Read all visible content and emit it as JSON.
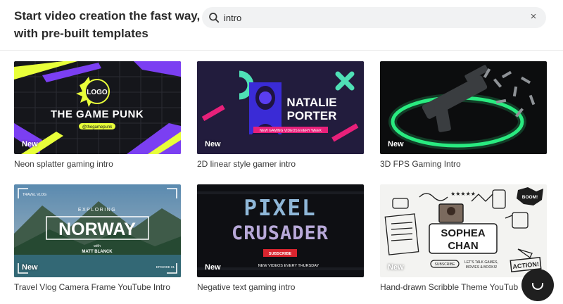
{
  "header": {
    "headline_line1": "Start video creation the fast way,",
    "headline_line2": "with pre-built templates"
  },
  "search": {
    "value": "intro",
    "clear_symbol": "×",
    "icon": "search-icon"
  },
  "badge_label": "New",
  "templates": [
    {
      "caption": "Neon splatter gaming intro",
      "thumb": {
        "logo": "LOGO",
        "title": "THE GAME PUNK",
        "handle": "@thegamepunk"
      }
    },
    {
      "caption": "2D linear style gamer intro",
      "thumb": {
        "title_line1": "NATALIE",
        "title_line2": "PORTER",
        "tagline": "NEW GAMING VIDEOS EVERY WEEK"
      }
    },
    {
      "caption": "3D FPS Gaming Intro",
      "thumb": {}
    },
    {
      "caption": "Travel Vlog Camera Frame YouTube Intro",
      "thumb": {
        "kicker": "TRAVEL VLOG",
        "pretitle": "EXPLORING",
        "title": "NORWAY",
        "with": "with",
        "host": "MATT BLANCK",
        "episode": "EPISODE 01"
      }
    },
    {
      "caption": "Negative text gaming intro",
      "thumb": {
        "title_line1": "PIXEL",
        "title_line2": "CRUSADER",
        "button": "SUBSCRIBE",
        "tagline": "NEW VIDEOS EVERY THURSDAY"
      }
    },
    {
      "caption": "Hand-drawn Scribble Theme YouTub",
      "thumb": {
        "title_line1": "SOPHEA",
        "title_line2": "CHAN",
        "boom": "BOOM!",
        "action": "ACTION!",
        "subscribe": "SUBSCRIBE",
        "blurb1": "LET'S TALK GAMES,",
        "blurb2": "MOVIES & BOOKS!",
        "stars": "★★★★★"
      }
    }
  ],
  "colors": {
    "search_bg": "#f1f2f3",
    "neon_yellow": "#e8ff3a",
    "neon_purple": "#7b3ff2",
    "magenta": "#e8207a",
    "mint": "#4fe0b6",
    "fps_green": "#2bff8a"
  }
}
